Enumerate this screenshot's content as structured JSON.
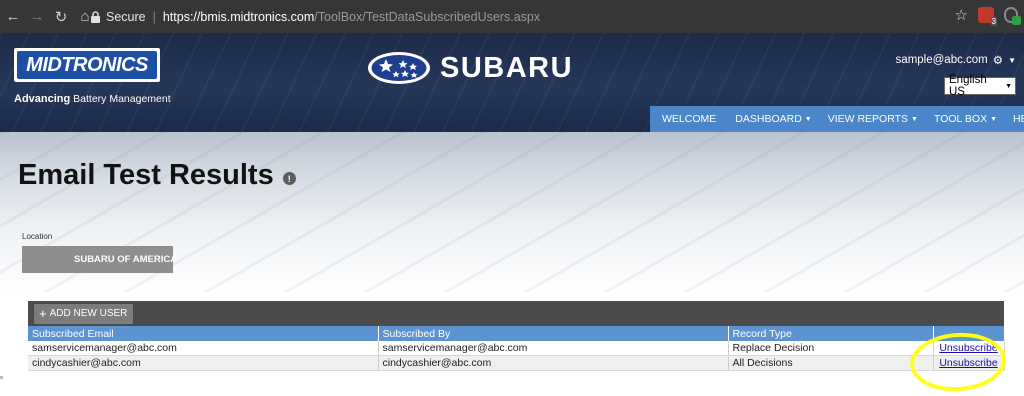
{
  "browser": {
    "secure_label": "Secure",
    "url_host": "https://bmis.midtronics.com",
    "url_path": "/ToolBox/TestDataSubscribedUsers.aspx",
    "extension_badge": "3"
  },
  "header": {
    "logo_text": "MIDTRONICS",
    "tagline_bold": "Advancing",
    "tagline_rest": " Battery Management",
    "brand_name": "SUBARU",
    "user_email": "sample@abc.com",
    "language": "English US",
    "nav": [
      {
        "label": "WELCOME",
        "has_caret": false
      },
      {
        "label": "DASHBOARD",
        "has_caret": true
      },
      {
        "label": "VIEW REPORTS",
        "has_caret": true
      },
      {
        "label": "TOOL BOX",
        "has_caret": true
      },
      {
        "label": "HELP",
        "has_caret": false
      }
    ]
  },
  "page": {
    "title": "Email Test Results",
    "location_label": "Location",
    "location_value": "SUBARU OF AMERICA !"
  },
  "grid": {
    "add_button_label": "ADD NEW USER",
    "columns": [
      "Subscribed Email",
      "Subscribed By",
      "Record Type",
      ""
    ],
    "rows": [
      {
        "email": "samservicemanager@abc.com",
        "by": "samservicemanager@abc.com",
        "type": "Replace Decision",
        "action": "Unsubscribe"
      },
      {
        "email": "cindycashier@abc.com",
        "by": "cindycashier@abc.com",
        "type": "All Decisions",
        "action": "Unsubscribe"
      }
    ]
  },
  "colors": {
    "header_bg": "#253759",
    "nav_bg": "#4a86c8",
    "grid_header_bg": "#5b94d0",
    "toolbar_bg": "#4b4b4b",
    "highlight": "#ffff1a"
  }
}
